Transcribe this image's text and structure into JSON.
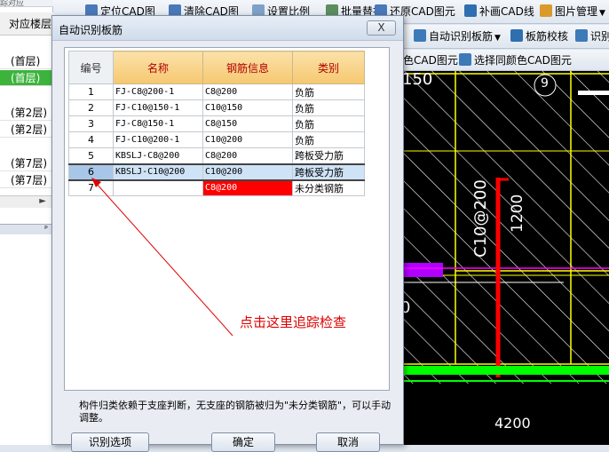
{
  "left_panel": {
    "top_text": "踪对应",
    "header": "对应楼层",
    "floors": [
      "(首层)",
      "(首层)",
      "(第2层)",
      "(第2层)",
      "(第7层)",
      "(第7层)"
    ],
    "active_index": 1,
    "dock_glyph": "ᵖ"
  },
  "toolbar1": {
    "items": [
      "定位CAD图",
      "清除CAD图",
      "设置比例",
      "批量替换",
      "还原CAD图元",
      "补画CAD线",
      "图片管理"
    ]
  },
  "toolbar2": {
    "items": [
      "自动识别板筋",
      "板筋校核",
      "识别"
    ]
  },
  "toolbar3": {
    "items": [
      "色CAD图元",
      "选择同颜色CAD图元"
    ]
  },
  "cad": {
    "texts": [
      "150",
      "C10@200",
      "1200",
      "9",
      "0",
      "4200"
    ],
    "colors": {
      "bg": "#000000",
      "hatch": "#ffffff",
      "yellow": "#ffff00",
      "magenta": "#ff00ff",
      "green": "#00ff00",
      "red": "#ff0000"
    }
  },
  "dialog": {
    "title": "自动识别板筋",
    "close_glyph": "X",
    "columns": [
      "编号",
      "名称",
      "钢筋信息",
      "类别"
    ],
    "rows": [
      {
        "no": "1",
        "name": "FJ-C8@200-1",
        "info": "C8@200",
        "type": "负筋"
      },
      {
        "no": "2",
        "name": "FJ-C10@150-1",
        "info": "C10@150",
        "type": "负筋"
      },
      {
        "no": "3",
        "name": "FJ-C8@150-1",
        "info": "C8@150",
        "type": "负筋"
      },
      {
        "no": "4",
        "name": "FJ-C10@200-1",
        "info": "C10@200",
        "type": "负筋"
      },
      {
        "no": "5",
        "name": "KBSLJ-C8@200",
        "info": "C8@200",
        "type": "跨板受力筋"
      },
      {
        "no": "6",
        "name": "KBSLJ-C10@200",
        "info": "C10@200",
        "type": "跨板受力筋"
      },
      {
        "no": "7",
        "name": "",
        "info": "C8@200",
        "type": "未分类钢筋"
      }
    ],
    "selected_row": 6,
    "note": "构件归类依赖于支座判断，无支座的钢筋被归为\"未分类钢筋\"，可以手动调整。",
    "buttons": {
      "options": "识别选项",
      "ok": "确定",
      "cancel": "取消"
    }
  },
  "annotation": {
    "text": "点击这里追踪检查",
    "color": "#e00000"
  }
}
